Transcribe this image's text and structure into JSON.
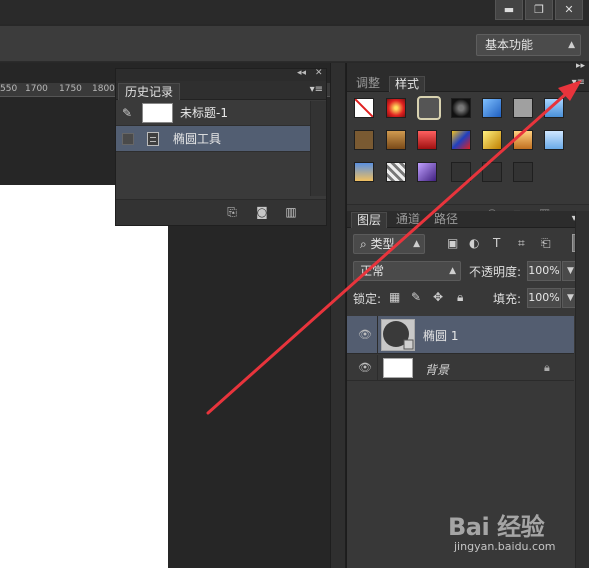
{
  "workspace": {
    "label": "基本功能"
  },
  "window_buttons": {
    "minimize": "▬",
    "restore": "❐",
    "close": "✕"
  },
  "ruler": {
    "ticks": [
      "550",
      "1700",
      "1750",
      "1800"
    ]
  },
  "history_panel": {
    "tab_label": "历史记录",
    "collapse_glyph": "◂◂",
    "close_glyph": "✕",
    "menu_glyph": "▾≡",
    "snapshot_label": "未标题-1",
    "items": [
      {
        "label": "椭圆工具"
      }
    ],
    "bottom_icons": [
      "new-document-from-state-icon",
      "camera-icon",
      "trash-icon"
    ]
  },
  "styles_panel": {
    "tabs": [
      "调整",
      "样式"
    ],
    "active_tab": "样式",
    "swatch_colors": [
      "#ffffff",
      "#e02020",
      "#d8d2b0",
      "#2c2c2c",
      "#1f6fd0",
      "#9a9a9a",
      "#5aa0e0",
      "#7a5a32",
      "#b07a3a",
      "#c02828",
      "#3a6ad0",
      "#d8b010",
      "#d4a030",
      "#8ab8e8",
      "#3a70c0",
      "#c8c8c8",
      "#5a3a9a",
      "#333333",
      "#333333",
      "#333333",
      "#444444"
    ]
  },
  "layers_panel": {
    "tabs": [
      "图层",
      "通道",
      "路径"
    ],
    "active_tab": "图层",
    "filter_kind": "类型",
    "blend_mode": "正常",
    "opacity_label": "不透明度:",
    "opacity_value": "100%",
    "lock_label": "锁定:",
    "fill_label": "填充:",
    "fill_value": "100%",
    "layers": [
      {
        "name": "椭圆 1",
        "selected": true,
        "type": "shape"
      },
      {
        "name": "背景",
        "selected": false,
        "type": "background",
        "locked": true
      }
    ]
  },
  "watermark": {
    "main": "Bai 经验",
    "sub": "jingyan.baidu.com"
  },
  "colors": {
    "accent_selection": "#535d70",
    "annotation_arrow": "#e8343c",
    "panel_bg": "#383838"
  }
}
